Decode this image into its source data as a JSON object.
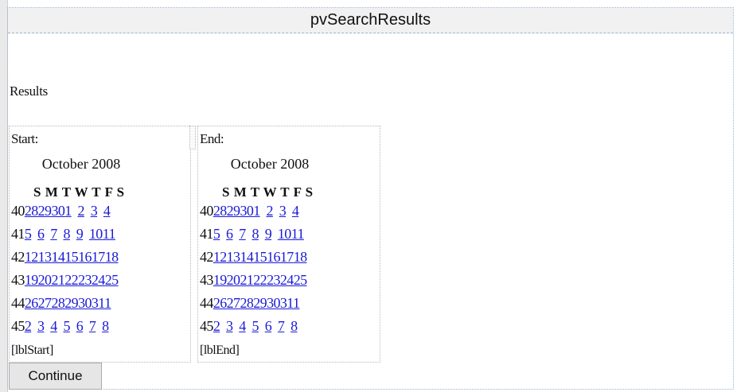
{
  "header": {
    "title": "pvSearchResults"
  },
  "results_label": "Results",
  "start_calendar": {
    "label": "Start:",
    "month": "October 2008",
    "days_header": "S M T W T F S",
    "weeks": [
      {
        "num": "40",
        "days": [
          "28",
          "29",
          "30",
          "1",
          "2",
          "3",
          "4"
        ]
      },
      {
        "num": "41",
        "days": [
          "5",
          "6",
          "7",
          "8",
          "9",
          "10",
          "11"
        ]
      },
      {
        "num": "42",
        "days": [
          "12",
          "13",
          "14",
          "15",
          "16",
          "17",
          "18"
        ]
      },
      {
        "num": "43",
        "days": [
          "19",
          "20",
          "21",
          "22",
          "23",
          "24",
          "25"
        ]
      },
      {
        "num": "44",
        "days": [
          "26",
          "27",
          "28",
          "29",
          "30",
          "31",
          "1"
        ]
      },
      {
        "num": "45",
        "days": [
          "2",
          "3",
          "4",
          "5",
          "6",
          "7",
          "8"
        ]
      }
    ],
    "bottom_label": "[lblStart]"
  },
  "end_calendar": {
    "label": "End:",
    "month": "October 2008",
    "days_header": "S M T W T F S",
    "weeks": [
      {
        "num": "40",
        "days": [
          "28",
          "29",
          "30",
          "1",
          "2",
          "3",
          "4"
        ]
      },
      {
        "num": "41",
        "days": [
          "5",
          "6",
          "7",
          "8",
          "9",
          "10",
          "11"
        ]
      },
      {
        "num": "42",
        "days": [
          "12",
          "13",
          "14",
          "15",
          "16",
          "17",
          "18"
        ]
      },
      {
        "num": "43",
        "days": [
          "19",
          "20",
          "21",
          "22",
          "23",
          "24",
          "25"
        ]
      },
      {
        "num": "44",
        "days": [
          "26",
          "27",
          "28",
          "29",
          "30",
          "31",
          "1"
        ]
      },
      {
        "num": "45",
        "days": [
          "2",
          "3",
          "4",
          "5",
          "6",
          "7",
          "8"
        ]
      }
    ],
    "bottom_label": "[lblEnd]"
  },
  "continue_button": {
    "label": "Continue"
  }
}
